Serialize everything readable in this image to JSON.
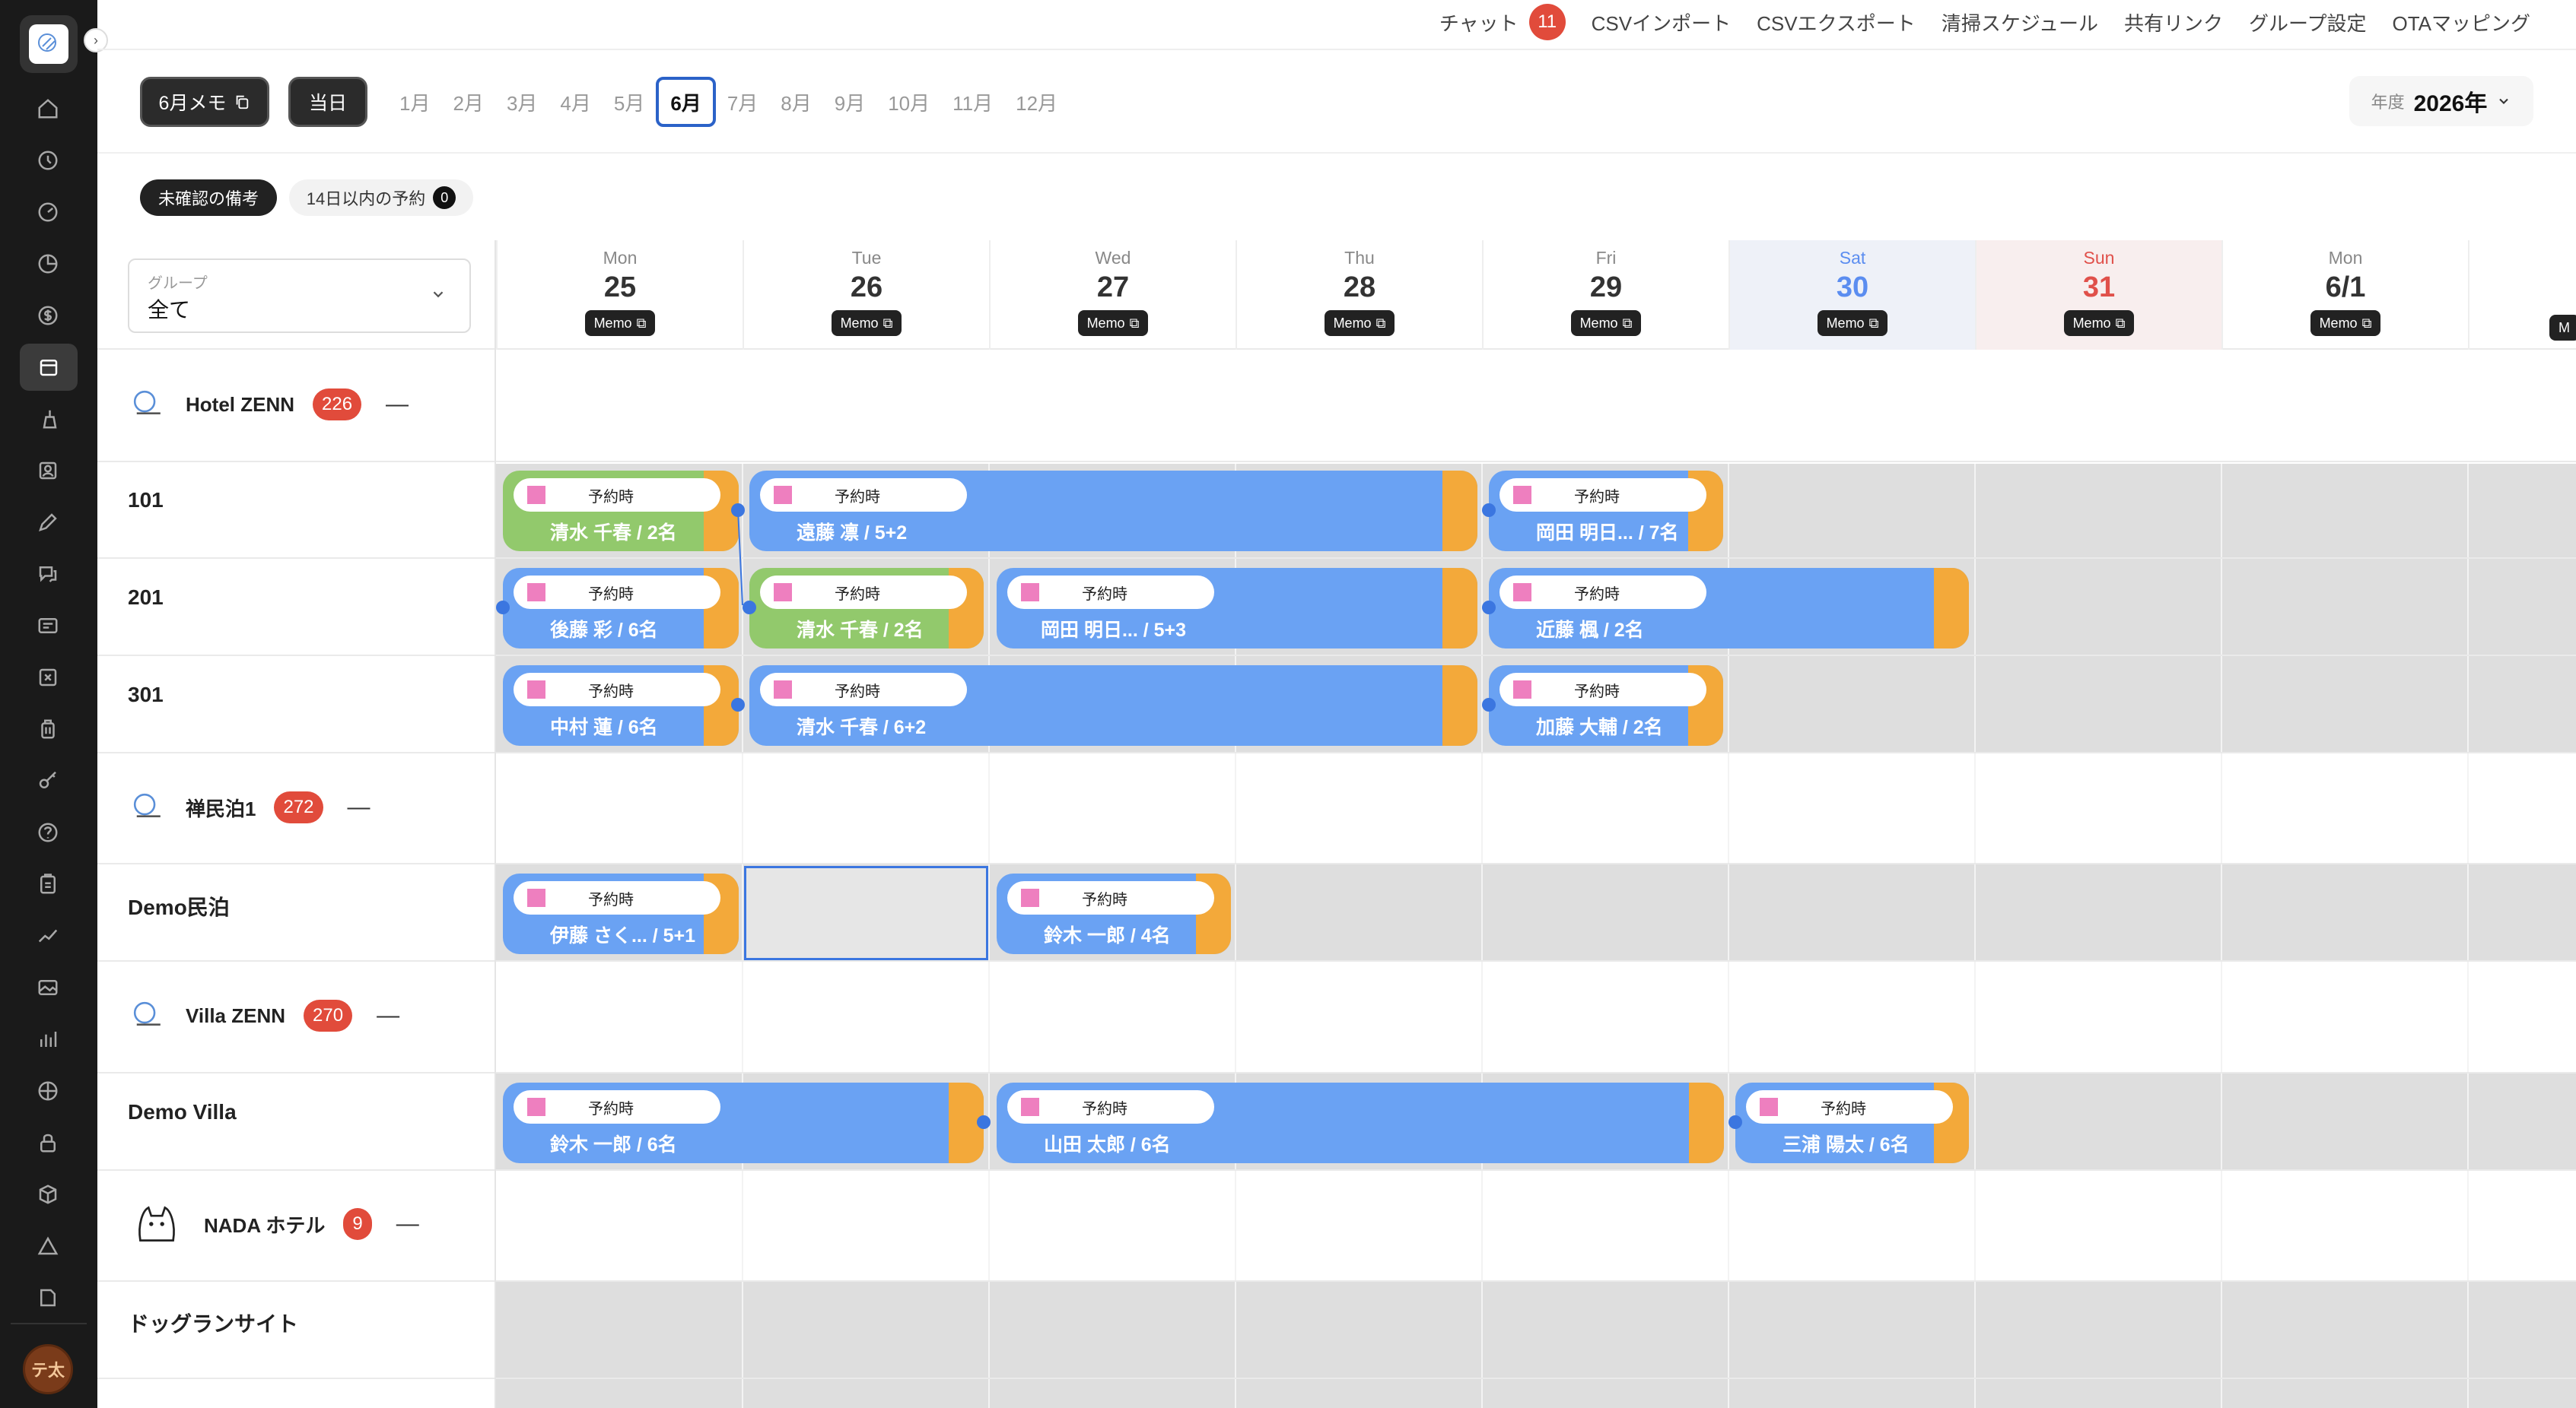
{
  "topnav": {
    "chat_label": "チャット",
    "chat_count": "11",
    "items": [
      "CSVインポート",
      "CSVエクスポート",
      "清掃スケジュール",
      "共有リンク",
      "グループ設定",
      "OTAマッピング"
    ]
  },
  "toolbar": {
    "memo_button": "6月メモ",
    "today_button": "当日",
    "months": [
      "1月",
      "2月",
      "3月",
      "4月",
      "5月",
      "6月",
      "7月",
      "8月",
      "9月",
      "10月",
      "11月",
      "12月"
    ],
    "selected_month": "6月",
    "year_caption": "年度",
    "year_value": "2026年"
  },
  "filters": {
    "unconfirmed": "未確認の備考",
    "within14": "14日以内の予約",
    "within14_count": "0"
  },
  "group_select": {
    "caption": "グループ",
    "value": "全て"
  },
  "days": [
    {
      "dow": "Mon",
      "num": "25",
      "memo": "Memo"
    },
    {
      "dow": "Tue",
      "num": "26",
      "memo": "Memo"
    },
    {
      "dow": "Wed",
      "num": "27",
      "memo": "Memo"
    },
    {
      "dow": "Thu",
      "num": "28",
      "memo": "Memo"
    },
    {
      "dow": "Fri",
      "num": "29",
      "memo": "Memo"
    },
    {
      "dow": "Sat",
      "num": "30",
      "memo": "Memo"
    },
    {
      "dow": "Sun",
      "num": "31",
      "memo": "Memo"
    },
    {
      "dow": "Mon",
      "num": "6/1",
      "memo": "Memo"
    }
  ],
  "groups": [
    {
      "name": "Hotel ZENN",
      "count": "226"
    },
    {
      "name": "禅民泊1",
      "count": "272"
    },
    {
      "name": "Villa ZENN",
      "count": "270"
    },
    {
      "name": "NADA ホテル",
      "count": "9"
    }
  ],
  "rooms": [
    "101",
    "201",
    "301",
    "Demo民泊",
    "Demo Villa",
    "ドッグランサイト"
  ],
  "bookings": [
    {
      "status": "予約時",
      "guest": "清水 千春 / 2名"
    },
    {
      "status": "予約時",
      "guest": "遠藤 凛 / 5+2"
    },
    {
      "status": "予約時",
      "guest": "岡田 明日... / 7名"
    },
    {
      "status": "予約時",
      "guest": "後藤 彩 / 6名"
    },
    {
      "status": "予約時",
      "guest": "清水 千春 / 2名"
    },
    {
      "status": "予約時",
      "guest": "岡田 明日... / 5+3"
    },
    {
      "status": "予約時",
      "guest": "近藤 楓 / 2名"
    },
    {
      "status": "予約時",
      "guest": "中村 蓮 / 6名"
    },
    {
      "status": "予約時",
      "guest": "清水 千春 / 6+2"
    },
    {
      "status": "予約時",
      "guest": "加藤 大輔 / 2名"
    },
    {
      "status": "予約時",
      "guest": "伊藤 さく... / 5+1"
    },
    {
      "status": "予約時",
      "guest": "鈴木 一郎 / 4名"
    },
    {
      "status": "予約時",
      "guest": "鈴木 一郎 / 6名"
    },
    {
      "status": "予約時",
      "guest": "山田 太郎 / 6名"
    },
    {
      "status": "予約時",
      "guest": "三浦 陽太 / 6名"
    }
  ],
  "user": {
    "avatar_text": "テ太"
  },
  "colors": {
    "accent": "#2b62c8",
    "booking_blue": "#6aa2f3",
    "booking_green": "#92c96c",
    "checkout_orange": "#f3a93a",
    "badge_red": "#e14b3b"
  }
}
